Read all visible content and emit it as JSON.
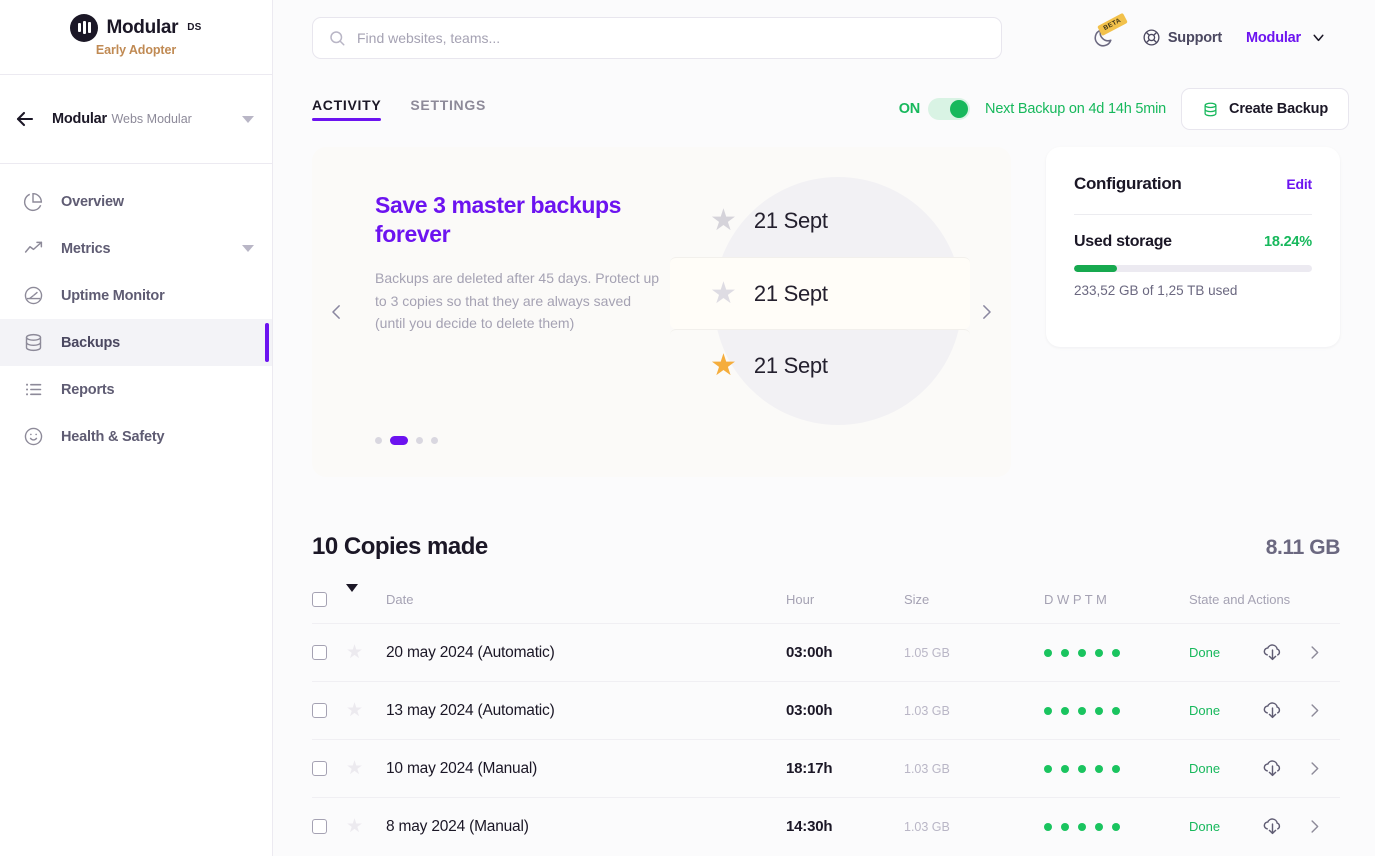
{
  "sidebar": {
    "brand": {
      "name": "Modular",
      "suffix": "DS",
      "tagline": "Early Adopter"
    },
    "project": {
      "name": "Modular",
      "subtitle": "Webs Modular"
    },
    "items": [
      {
        "label": "Overview",
        "icon": "pie-chart-icon",
        "active": false,
        "has_caret": false
      },
      {
        "label": "Metrics",
        "icon": "trending-up-icon",
        "active": false,
        "has_caret": true
      },
      {
        "label": "Uptime Monitor",
        "icon": "gauge-icon",
        "active": false,
        "has_caret": false
      },
      {
        "label": "Backups",
        "icon": "database-icon",
        "active": true,
        "has_caret": false
      },
      {
        "label": "Reports",
        "icon": "list-icon",
        "active": false,
        "has_caret": false
      },
      {
        "label": "Health & Safety",
        "icon": "smiley-icon",
        "active": false,
        "has_caret": false
      }
    ]
  },
  "topbar": {
    "search": {
      "placeholder": "Find websites, teams...",
      "value": "",
      "icon": "search-icon"
    },
    "dark_mode": {
      "icon": "moon-icon",
      "badge": "BETA"
    },
    "support": {
      "label": "Support",
      "icon": "lifebuoy-icon"
    },
    "user": {
      "label": "Modular",
      "icon": "chevron-down-icon"
    }
  },
  "tabs": [
    {
      "label": "ACTIVITY",
      "active": true
    },
    {
      "label": "SETTINGS",
      "active": false
    }
  ],
  "backup_controls": {
    "toggle_label": "ON",
    "toggle_on": true,
    "next_backup": "Next Backup on 4d 14h 5min",
    "create_button": "Create Backup",
    "create_icon": "database-icon"
  },
  "banner": {
    "title": "Save 3 master backups forever",
    "description": "Backups are deleted after 45 days. Protect up to 3 copies so that they are always saved (until you decide to delete them)",
    "prev_icon": "chevron-left-icon",
    "next_icon": "chevron-right-icon",
    "dots_total": 4,
    "dots_active_index": 1,
    "illustration_rows": [
      {
        "star": "star-icon",
        "star_state": "empty",
        "date": "21 Sept"
      },
      {
        "star": "star-icon",
        "star_state": "empty",
        "date": "21 Sept"
      },
      {
        "star": "star-icon",
        "star_state": "filled",
        "date": "21 Sept"
      }
    ]
  },
  "configuration": {
    "title": "Configuration",
    "edit_label": "Edit",
    "storage_title": "Used storage",
    "storage_percent": "18.24%",
    "storage_percent_value": 18.24,
    "storage_detail": "233,52 GB of 1,25 TB used"
  },
  "copies": {
    "title": "10 Copies made",
    "total_size": "8.11 GB",
    "columns": {
      "checkbox": "",
      "sort": "sort-desc-icon",
      "date": "Date",
      "hour": "Hour",
      "size": "Size",
      "dwptm": "D W P T M",
      "state": "State and Actions"
    },
    "rows": [
      {
        "date": "20 may 2024 (Automatic)",
        "hour": "03:00h",
        "size": "1.05 GB",
        "dots": 5,
        "state": "Done",
        "star": "empty"
      },
      {
        "date": "13 may 2024 (Automatic)",
        "hour": "03:00h",
        "size": "1.03 GB",
        "dots": 5,
        "state": "Done",
        "star": "empty"
      },
      {
        "date": "10 may 2024 (Manual)",
        "hour": "18:17h",
        "size": "1.03 GB",
        "dots": 5,
        "state": "Done",
        "star": "empty"
      },
      {
        "date": "8 may 2024 (Manual)",
        "hour": "14:30h",
        "size": "1.03 GB",
        "dots": 5,
        "state": "Done",
        "star": "empty"
      }
    ]
  },
  "colors": {
    "accent_purple": "#6c13f0",
    "success_green": "#17b85c",
    "dot_green": "#1ac45f",
    "gold_star": "#f5ad3c",
    "brand_tagline": "#c08a53",
    "text_dark": "#1b1726",
    "text_muted": "#8d8a99"
  }
}
